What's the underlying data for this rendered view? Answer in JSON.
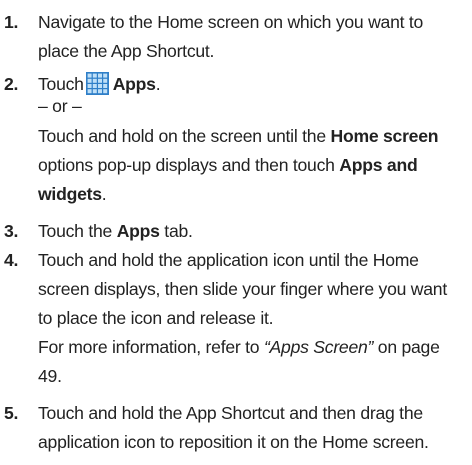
{
  "steps": [
    {
      "number": "1.",
      "text": "Navigate to the Home screen on which you want to place the App Shortcut."
    },
    {
      "number": "2.",
      "touch": "Touch",
      "apps_label": "Apps",
      "period": ".",
      "or": "– or –",
      "alt_part1": "Touch and hold on the screen until the ",
      "alt_bold1": "Home screen",
      "alt_part2": " options pop-up displays and then touch ",
      "alt_bold2": "Apps and widgets",
      "alt_period": "."
    },
    {
      "number": "3.",
      "part1": "Touch the ",
      "bold": "Apps",
      "part2": " tab."
    },
    {
      "number": "4.",
      "text": "Touch and hold the application icon until the Home screen displays, then slide your finger where you want to place the icon and release it.",
      "ref_part1": "For more information, refer to ",
      "ref_link": "“Apps Screen”",
      "ref_part2": " on page 49."
    },
    {
      "number": "5.",
      "text": "Touch and hold the App Shortcut and then drag the application icon to reposition it on the Home screen."
    }
  ],
  "icon": {
    "name": "apps-grid-icon",
    "color_dark": "#2f7fc8",
    "color_light": "#bfe0f8"
  }
}
